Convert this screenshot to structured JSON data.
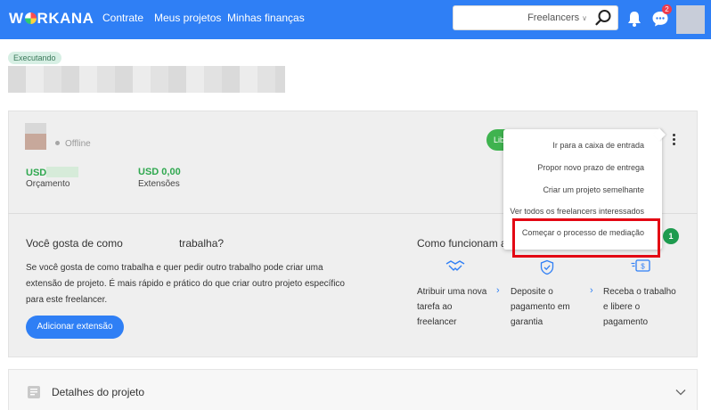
{
  "header": {
    "logo": {
      "part1": "W",
      "part2": "RKANA"
    },
    "nav": [
      {
        "label": "Contrate"
      },
      {
        "label": "Meus projetos"
      },
      {
        "label": "Minhas finanças"
      }
    ],
    "search_filter": "Freelancers",
    "chat_badge_count": "2"
  },
  "project": {
    "status": "Executando"
  },
  "freelancer_card": {
    "online_status": "Offline",
    "budget_value": "USD",
    "budget_label": "Orçamento",
    "extensions_value": "USD 0,00",
    "extensions_label": "Extensões",
    "green_button_label": "Lib"
  },
  "dropdown_menu": {
    "items": [
      {
        "label": "Ir para a caixa de entrada"
      },
      {
        "label": "Propor novo prazo de entrega"
      },
      {
        "label": "Criar um projeto semelhante"
      },
      {
        "label": "Ver todos os freelancers interessados"
      },
      {
        "label": "Começar o processo de mediação"
      }
    ],
    "highlighted_index": 4,
    "highlight_color": "#e30613"
  },
  "step_badge": "1",
  "extension_pitch": {
    "title_part1": "Você gosta de como",
    "title_part2": "trabalha?",
    "text": "Se você gosta de como trabalha e quer pedir outro trabalho pode criar uma extensão de projeto. É mais rápido e prático do que criar outro projeto específico para este freelancer.",
    "button_label": "Adicionar extensão"
  },
  "how_it_works": {
    "title": "Como funcionam as",
    "steps": [
      {
        "line1": "Atribuir uma nova",
        "line2": "tarefa ao",
        "line3": "freelancer",
        "icon": "handshake-icon"
      },
      {
        "line1": "Deposite o",
        "line2": "pagamento em",
        "line3": "garantia",
        "icon": "shield-check-icon"
      },
      {
        "line1": "Receba o trabalho",
        "line2": "e libere o",
        "line3": "pagamento",
        "icon": "money-icon"
      }
    ]
  },
  "details": {
    "title": "Detalhes do projeto"
  },
  "colors": {
    "brand_blue": "#2f7ff5",
    "success_green": "#2fa84f",
    "badge_red": "#ef3b4d"
  }
}
